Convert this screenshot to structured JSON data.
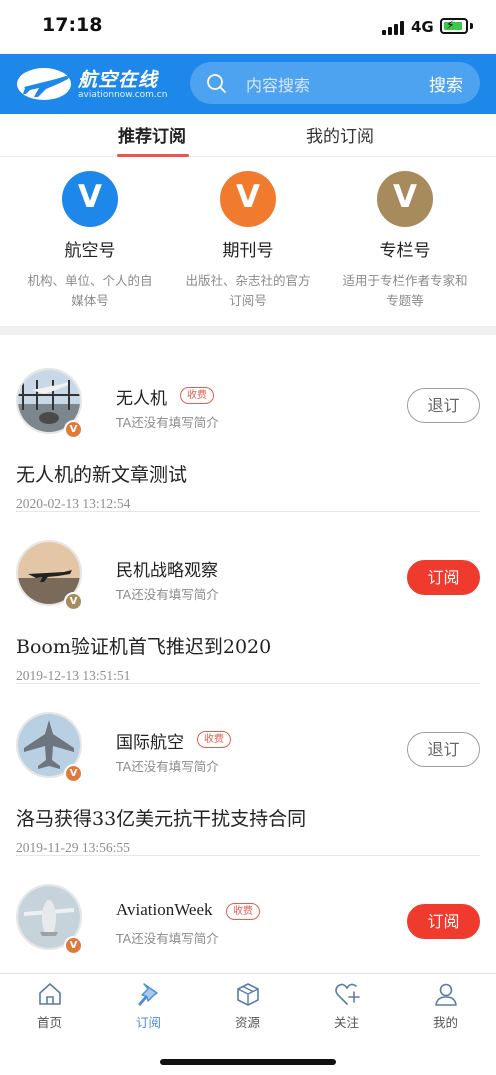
{
  "status_bar": {
    "time": "17:18",
    "network": "4G",
    "battery_color": "#3cc94a"
  },
  "header": {
    "logo_title": "航空在线",
    "logo_subtitle": "aviationnow.com.cn",
    "search_placeholder": "内容搜索",
    "search_button": "搜索",
    "brand_color": "#1e87ea"
  },
  "tabs": [
    {
      "label": "推荐订阅",
      "active": true
    },
    {
      "label": "我的订阅",
      "active": false
    }
  ],
  "categories": [
    {
      "badge": "V",
      "title": "航空号",
      "desc": "机构、单位、个人的自媒体号",
      "color": "#1e87ea"
    },
    {
      "badge": "V",
      "title": "期刊号",
      "desc": "出版社、杂志社的官方订阅号",
      "color": "#f07a2d"
    },
    {
      "badge": "V",
      "title": "专栏号",
      "desc": "适用于专栏作者专家和专题等",
      "color": "#a88b5c"
    }
  ],
  "feed": [
    {
      "name": "无人机",
      "fee": "收费",
      "desc": "TA还没有填写简介",
      "button": "退订",
      "button_type": "unsub",
      "badge_color": "#e07a3c",
      "title": "无人机的新文章测试",
      "date": "2020-02-13 13:12:54"
    },
    {
      "name": "民机战略观察",
      "fee": "",
      "desc": "TA还没有填写简介",
      "button": "订阅",
      "button_type": "sub",
      "badge_color": "#a88b5c",
      "title": "Boom验证机首飞推迟到2020",
      "date": "2019-12-13 13:51:51"
    },
    {
      "name": "国际航空",
      "fee": "收费",
      "desc": "TA还没有填写简介",
      "button": "退订",
      "button_type": "unsub",
      "badge_color": "#e07a3c",
      "title": "洛马获得33亿美元抗干扰支持合同",
      "date": "2019-11-29 13:56:55"
    },
    {
      "name": "AviationWeek",
      "fee": "收费",
      "desc": "TA还没有填写简介",
      "button": "订阅",
      "button_type": "sub",
      "badge_color": "#e07a3c",
      "title": "",
      "date": ""
    }
  ],
  "bottom_nav": [
    {
      "label": "首页",
      "icon": "home-icon",
      "active": false
    },
    {
      "label": "订阅",
      "icon": "pin-icon",
      "active": true
    },
    {
      "label": "资源",
      "icon": "box-icon",
      "active": false
    },
    {
      "label": "关注",
      "icon": "heart-plus-icon",
      "active": false
    },
    {
      "label": "我的",
      "icon": "user-icon",
      "active": false
    }
  ]
}
